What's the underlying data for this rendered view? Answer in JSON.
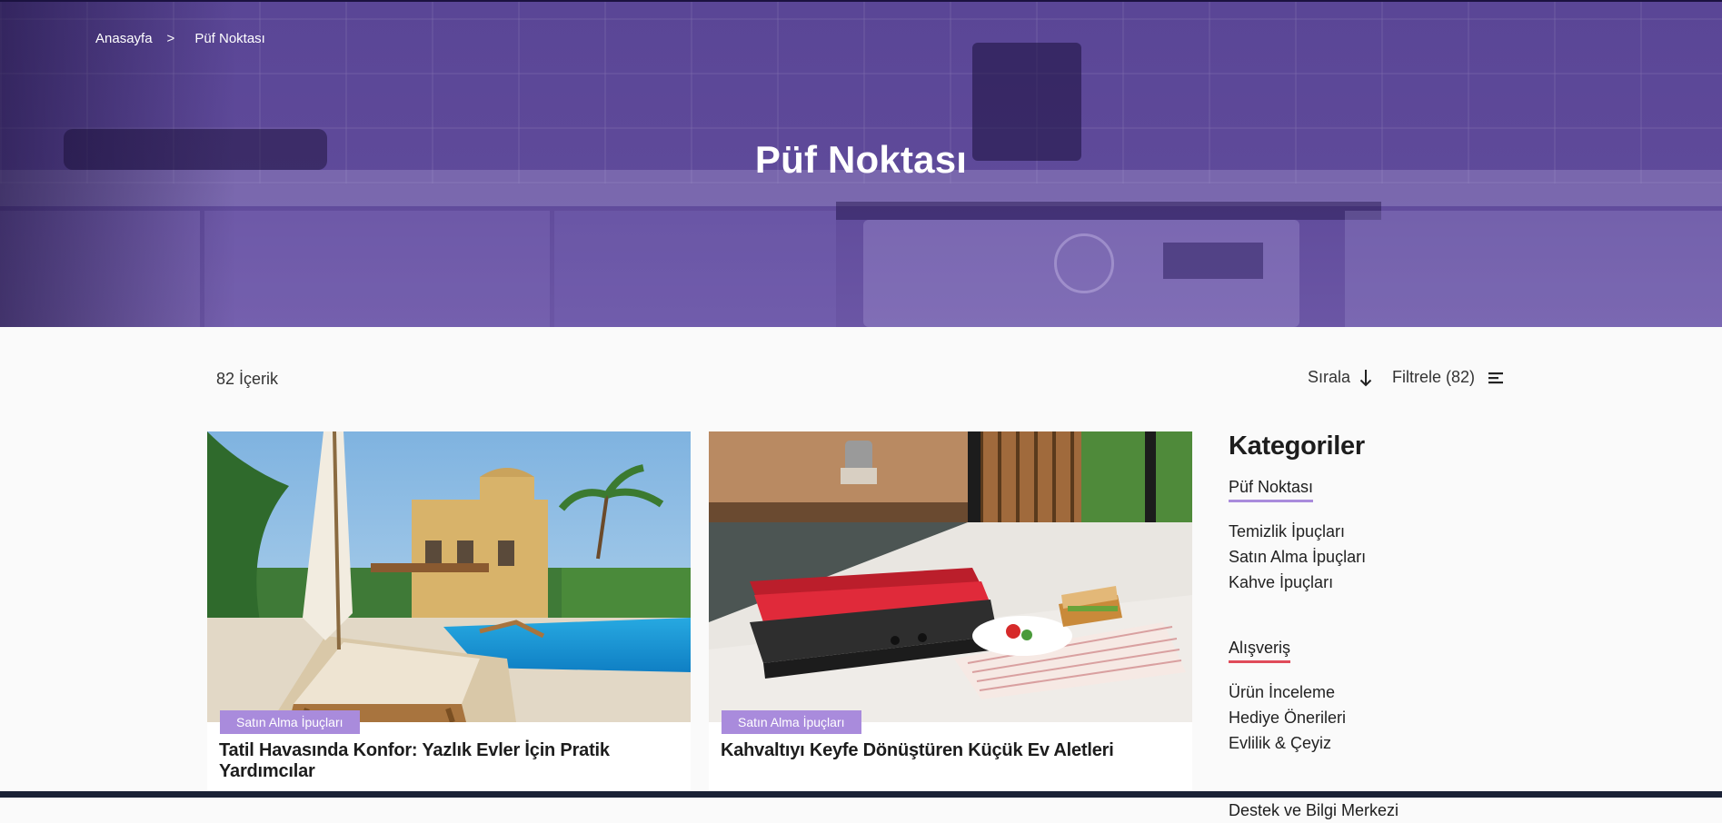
{
  "breadcrumb": {
    "home": "Anasayfa",
    "separator": ">",
    "current": "Püf Noktası"
  },
  "hero": {
    "title": "Püf Noktası",
    "tint_color": "#5f4a9a"
  },
  "toolbar": {
    "count_label": "82 İçerik",
    "sort_label": "Sırala",
    "filter_label": "Filtrele (82)"
  },
  "cards": [
    {
      "badge": "Satın Alma İpuçları",
      "title": "Tatil Havasında Konfor: Yazlık Evler İçin Pratik Yardımcılar"
    },
    {
      "badge": "Satın Alma İpuçları",
      "title": "Kahvaltıyı Keyfe Dönüştüren Küçük Ev Aletleri"
    }
  ],
  "sidebar": {
    "title": "Kategoriler",
    "groups": [
      {
        "heading": "Püf Noktası",
        "accent": "#a98bdc",
        "items": [
          "Temizlik İpuçları",
          "Satın Alma İpuçları",
          "Kahve İpuçları"
        ]
      },
      {
        "heading": "Alışveriş",
        "accent": "#e04b5a",
        "items": [
          "Ürün İnceleme",
          "Hediye Önerileri",
          "Evlilik & Çeyiz"
        ]
      },
      {
        "heading": "Destek ve Bilgi Merkezi"
      }
    ]
  },
  "colors": {
    "badge": "#a98bdc",
    "accent_red": "#e04b5a",
    "hero": "#5f4a9a"
  },
  "icons": {
    "sort": "arrow-down-icon",
    "filter": "filter-lines-icon"
  }
}
